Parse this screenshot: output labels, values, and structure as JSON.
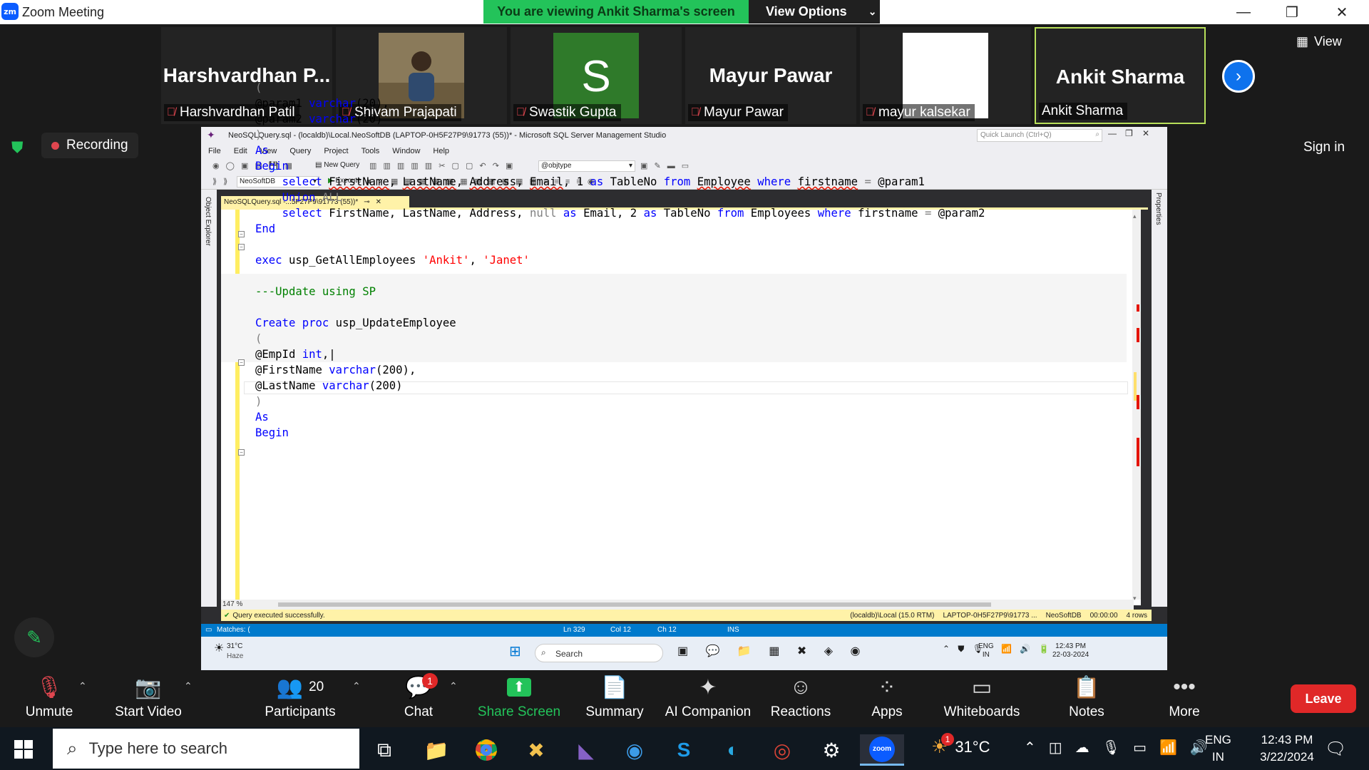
{
  "window": {
    "logo": "zm",
    "title": "Zoom Meeting",
    "viewing_banner": "You are viewing Ankit Sharma's screen",
    "view_options": "View Options"
  },
  "participants_strip": {
    "tiles": [
      {
        "big_name": "Harshvardhan  P...",
        "label": "Harshvardhan Patil",
        "muted": true
      },
      {
        "big_name": "",
        "label": "Shivam Prajapati",
        "muted": true
      },
      {
        "big_name": "S",
        "label": "Swastik Gupta",
        "muted": true
      },
      {
        "big_name": "Mayur Pawar",
        "label": "Mayur Pawar",
        "muted": true
      },
      {
        "big_name": "",
        "label": "mayur kalsekar",
        "muted": true
      },
      {
        "big_name": "Ankit Sharma",
        "label": "Ankit Sharma",
        "muted": false
      }
    ],
    "view_label": "View"
  },
  "status": {
    "recording": "Recording",
    "sign_in": "Sign in"
  },
  "ssms": {
    "title": "NeoSQLQuery.sql - (localdb)\\Local.NeoSoftDB (LAPTOP-0H5F27P9\\91773 (55))* - Microsoft SQL Server Management Studio",
    "quick_launch": "Quick Launch (Ctrl+Q)",
    "menu": [
      "File",
      "Edit",
      "View",
      "Query",
      "Project",
      "Tools",
      "Window",
      "Help"
    ],
    "new_query": "New Query",
    "objtype": "@objtype",
    "database": "NeoSoftDB",
    "execute": "Execute",
    "object_explorer": "Object Explorer",
    "properties": "Properties",
    "doc_tab": "NeoSQLQuery.sql -...5F27P9\\91773 (55))*",
    "zoom_level": "147 %",
    "query_status": "Query executed successfully.",
    "status_right": [
      "(localdb)\\Local (15.0 RTM)",
      "LAPTOP-0H5F27P9\\91773 ...",
      "NeoSoftDB",
      "00:00:00",
      "4 rows"
    ],
    "bottom_status": {
      "matches": "Matches: (",
      "ln": "Ln 329",
      "col": "Col 12",
      "ch": "Ch 12",
      "mode": "INS"
    },
    "inner_taskbar": {
      "temp": "31°C",
      "weather": "Haze",
      "search": "Search",
      "lang1": "ENG",
      "lang2": "IN",
      "time": "12:43 PM",
      "date": "22-03-2024"
    }
  },
  "controls": {
    "unmute": "Unmute",
    "start_video": "Start Video",
    "participants": "Participants",
    "participants_count": "20",
    "chat": "Chat",
    "chat_badge": "1",
    "share_screen": "Share Screen",
    "summary": "Summary",
    "ai_companion": "AI Companion",
    "reactions": "Reactions",
    "apps": "Apps",
    "whiteboards": "Whiteboards",
    "notes": "Notes",
    "more": "More",
    "leave": "Leave"
  },
  "taskbar": {
    "search_placeholder": "Type here to search",
    "weather_badge": "1",
    "temperature": "31°C",
    "lang1": "ENG",
    "lang2": "IN",
    "time": "12:43 PM",
    "date": "3/22/2024"
  }
}
